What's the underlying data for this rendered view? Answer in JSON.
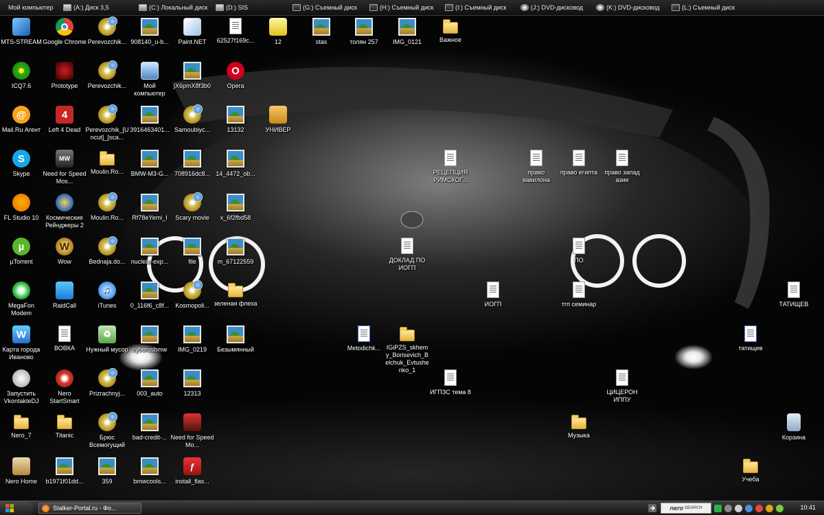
{
  "drives": [
    {
      "label": "Мой компьютер",
      "type": "pc"
    },
    {
      "label": "(A:) Диск 3,5",
      "type": "fd"
    },
    {
      "label": "(C:) Локальный диск",
      "type": "hd"
    },
    {
      "label": "(D:) SIS",
      "type": "hd"
    },
    {
      "label": "(G:) Съемный диск",
      "type": "rem"
    },
    {
      "label": "(H:) Съемный диск",
      "type": "rem"
    },
    {
      "label": "(I:) Съемный диск",
      "type": "rem"
    },
    {
      "label": "(J:) DVD-дисковод",
      "type": "dvd"
    },
    {
      "label": "(K:) DVD-дисковод",
      "type": "dvd"
    },
    {
      "label": "(L:) Съемный диск",
      "type": "rem"
    }
  ],
  "icons": {
    "mts": "MTS-STREAM",
    "chrome": "Google Chrome",
    "perev1": "Perevozchik...",
    "img908140": "908140_u-b...",
    "paintnet": "Paint.NET",
    "f62527": "62527f169c...",
    "n12": "12",
    "stas": "stas",
    "tolyan": "толян 257",
    "img0121": "IMG_0121",
    "vazhnoe": "Важное",
    "icq": "ICQ7.6",
    "prototype": "Prototype",
    "perev2": "Perevozchik...",
    "mycomp": "Мой компьютер",
    "jx6": "jX6pmX8f3b0",
    "opera": "Opera",
    "mailru": "Mail.Ru Агент",
    "l4d": "Left 4 Dead",
    "perev3": "Perevozchik_[Uncut]_[sca...",
    "n391646": "3916463401...",
    "samoubiy": "Samoubiyc...",
    "n13132": "13132",
    "univer": "УНИВЕР",
    "skype": "Skype",
    "nfsmw": "Need for Speed Mos...",
    "moulin1": "Moulin.Ro...",
    "bmwm3": "BMW-M3-G...",
    "n708916": "708916dc8...",
    "n14_4472": "14_4472_ob...",
    "recepciya": "РЕЦЕПЦИЯ РИМСКОГ...",
    "pravo_vav": "право вавилона",
    "pravo_eg": "право египта",
    "pravo_zap": "право запад азии",
    "flstudio": "FL Studio 10",
    "kosmich": "Космические Рейнджеры 2",
    "moulin2": "Moulin.Ro...",
    "rf7": "Rf78eYemi_I",
    "scary": "Scary movie",
    "x6f2": "x_6f2fbd58",
    "utorrent": "µTorrent",
    "wow": "Wow",
    "bednaja": "Bednaja.do...",
    "nuclear": "nuclear-exp...",
    "file": "file",
    "m6712": "m_67122559",
    "doklad": "ДОКЛАД ПО ИОГП",
    "po": "ПО",
    "megafon": "MegaFon Modem",
    "raidcall": "RaidCall",
    "itunes": "iTunes",
    "n0_116": "0_116f6_c8f...",
    "kosmopoli": "Kosmopoli...",
    "zelenaya": "зеленая флеха",
    "iogp": "ИОГП",
    "tgp": "тгп семинар",
    "tatishev1": "ТАТИЩЕВ",
    "karta": "Карта города Иваново",
    "vovka": "ВОВКА",
    "musor": "Нужный мусор",
    "cyberus": "cyberusbmw",
    "img0219": "IMG_0219",
    "bezym": "Безымянный",
    "metodich": "Metodichk...",
    "igipzs": "IGiPZS_skhemy_Borisevich_Belchuk_Evtushenko_1",
    "tatishev2": "татищев",
    "vkdj": "Запустить VkontakteDJ",
    "nerosmart": "Nero StartSmart",
    "prizrach": "Prizrachnyj...",
    "auto003": "003_auto",
    "n12313": "12313",
    "igpzs8": "ИГПЗС тема 8",
    "ciceron": "ЦИЦЕРОН ИППУ",
    "nero7": "Nero_7",
    "titanic": "Titanic",
    "brus": "Брюс Всемогущий",
    "badcredit": "bad-credit-...",
    "nfs2": "Need for Speed Mo...",
    "muzyka": "Музыка",
    "korzina": "Корзина",
    "nerohome": "Nero Home",
    "b1971": "b1971f01dd...",
    "n359": "359",
    "bmwcools": "bmwcools...",
    "installflash": "install_flas...",
    "ucheba": "Учеба"
  },
  "taskbar": {
    "task_label": "Stalker-Portal.ru - Фо...",
    "nero_label": "nero",
    "nero_sub": "SEARCH",
    "clock": "10:41"
  },
  "colors": {
    "taskbar": "#1e1e1e",
    "drivebar": "#1a1a1a",
    "desktop": "#050505"
  }
}
